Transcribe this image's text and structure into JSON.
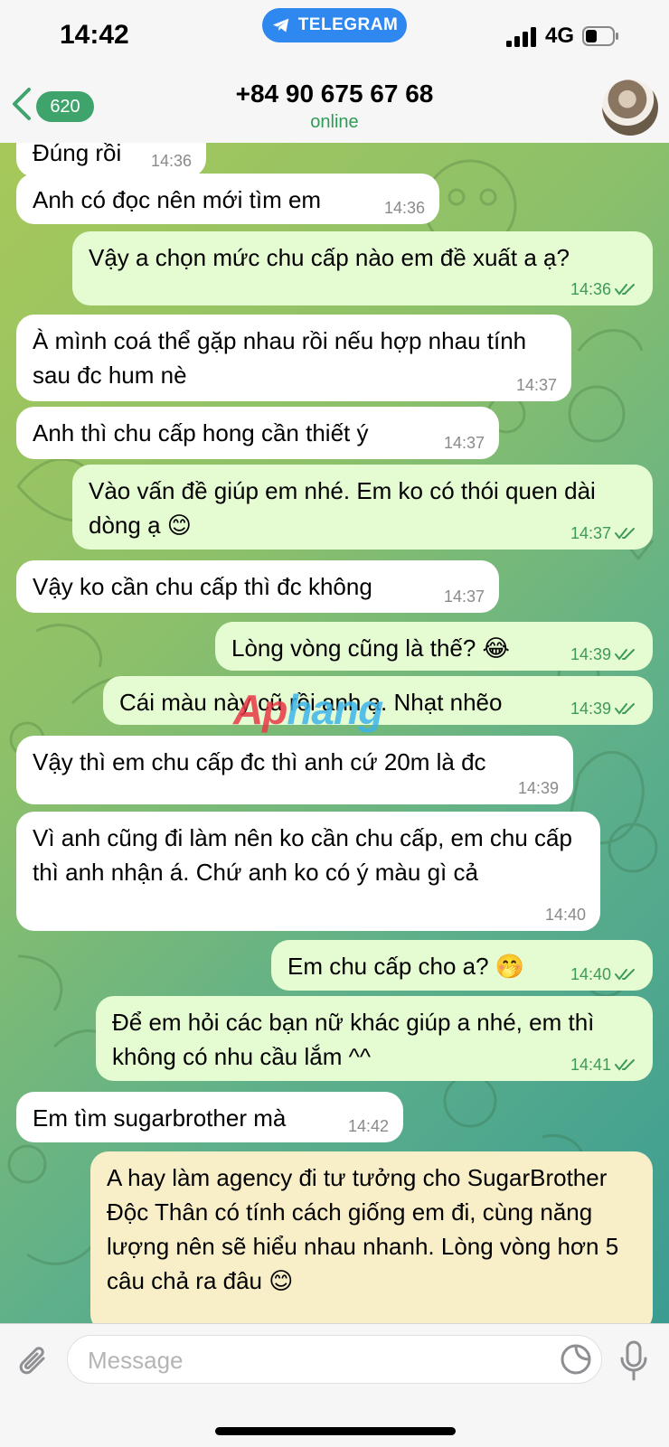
{
  "status_bar": {
    "time": "14:42",
    "app_pill": "TELEGRAM",
    "network": "4G"
  },
  "header": {
    "back_count": "620",
    "contact": "+84 90 675 67 68",
    "status": "online"
  },
  "messages": [
    {
      "dir": "in",
      "text": "Đúng rồi",
      "time": "14:36"
    },
    {
      "dir": "in",
      "text": "Anh có đọc nên mới tìm em",
      "time": "14:36"
    },
    {
      "dir": "out",
      "text": "Vậy a chọn mức chu cấp nào em đề xuất a ạ?",
      "time": "14:36"
    },
    {
      "dir": "in",
      "text": "À mình coá thể gặp nhau rồi nếu hợp nhau tính sau đc hum nè",
      "time": "14:37"
    },
    {
      "dir": "in",
      "text": "Anh thì chu cấp hong cần thiết ý",
      "time": "14:37"
    },
    {
      "dir": "out",
      "text": "Vào vấn đề giúp em nhé. Em ko có thói quen dài dòng ạ 😊",
      "time": "14:37"
    },
    {
      "dir": "in",
      "text": "Vậy ko cần chu cấp thì đc không",
      "time": "14:37"
    },
    {
      "dir": "out",
      "text": "Lòng vòng cũng là thế? 😂",
      "time": "14:39"
    },
    {
      "dir": "out",
      "text": "Cái màu này cũ rồi anh ạ. Nhạt nhẽo",
      "time": "14:39"
    },
    {
      "dir": "in",
      "text": "Vậy thì em chu cấp đc thì anh cứ 20m là đc",
      "time": "14:39"
    },
    {
      "dir": "in",
      "text": "Vì anh cũng đi làm nên ko cần chu cấp, em chu cấp thì anh nhận á. Chứ anh ko có ý màu gì cả",
      "time": "14:40"
    },
    {
      "dir": "out",
      "text": "Em chu cấp cho a? 🤭",
      "time": "14:40"
    },
    {
      "dir": "out",
      "text": "Để em hỏi các bạn nữ khác giúp a nhé, em thì không có nhu cầu lắm ^^",
      "time": "14:41"
    },
    {
      "dir": "in",
      "text": "Em tìm sugarbrother mà",
      "time": "14:42"
    },
    {
      "dir": "out",
      "text": "A hay làm agency đi tư tưởng cho SugarBrother Độc Thân có tính cách giống em đi, cùng năng lượng nên sẽ hiểu nhau nhanh. Lòng vòng hơn 5 câu chả ra đâu 😊",
      "time": ""
    }
  ],
  "watermark": {
    "part1": "Ap",
    "part2": "hang"
  },
  "input": {
    "placeholder": "Message"
  },
  "colors": {
    "accent": "#3ea46b",
    "incoming": "#ffffff",
    "outgoing": "#e5fbd1",
    "pill": "#2f88f0"
  }
}
